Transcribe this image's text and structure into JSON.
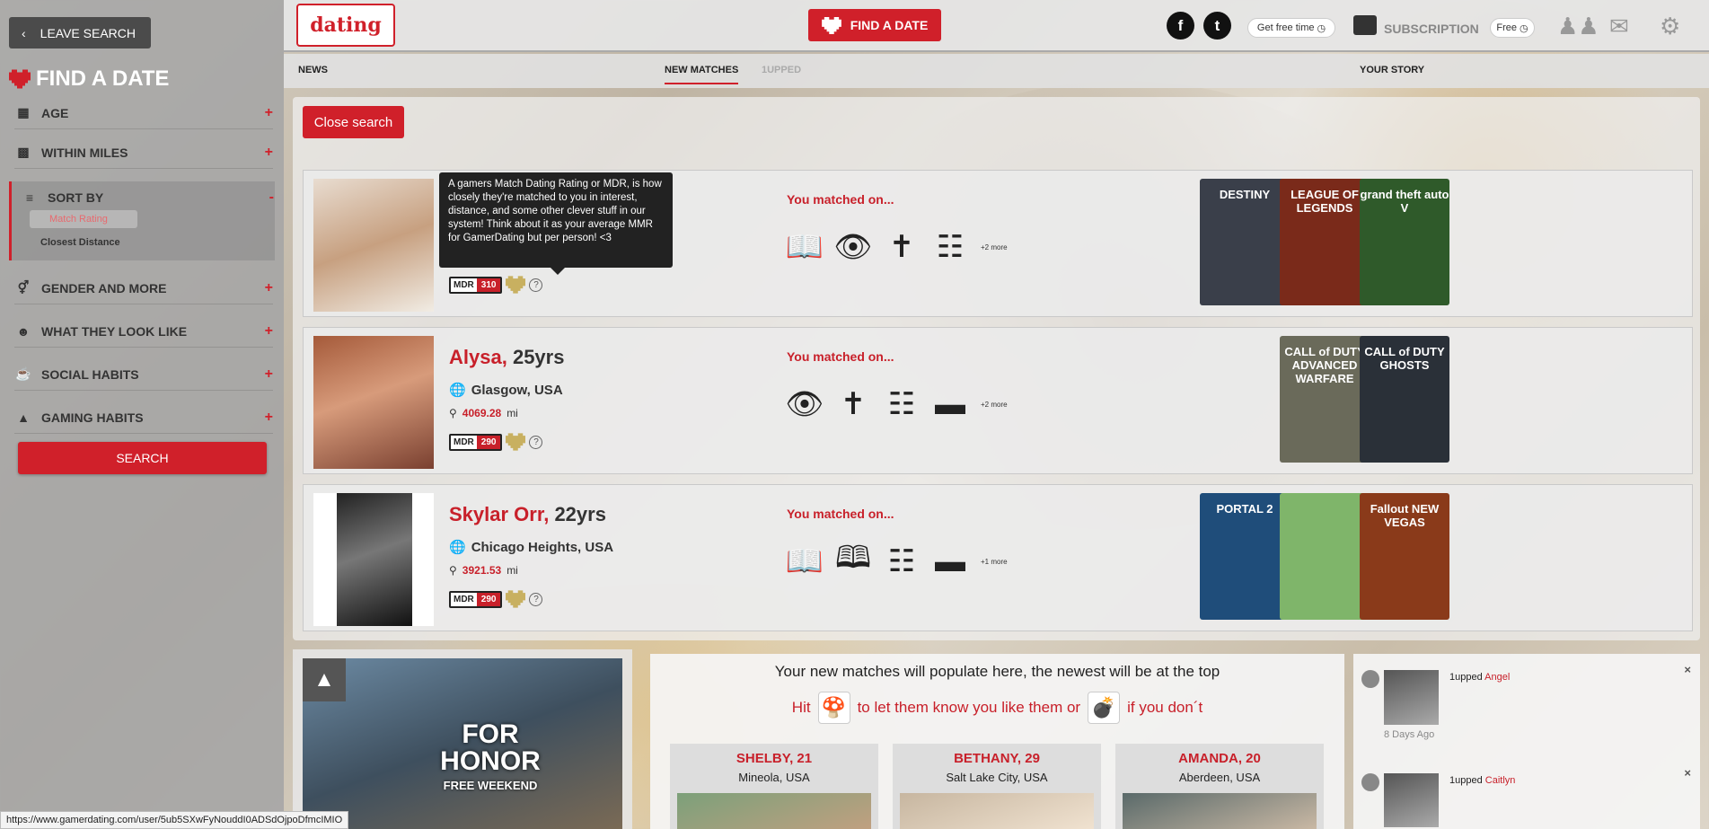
{
  "sidebar": {
    "leave_search": "LEAVE SEARCH",
    "title": "FIND A DATE",
    "filters": [
      {
        "label": "AGE",
        "icon": "calendar-icon"
      },
      {
        "label": "WITHIN MILES",
        "icon": "car-icon"
      },
      {
        "label": "SORT BY",
        "icon": "sliders-icon",
        "expanded_symbol": "-"
      },
      {
        "label": "GENDER AND MORE",
        "icon": "gender-icon"
      },
      {
        "label": "WHAT THEY LOOK LIKE",
        "icon": "face-icon"
      },
      {
        "label": "SOCIAL HABITS",
        "icon": "cup-icon"
      },
      {
        "label": "GAMING HABITS",
        "icon": "gamepad-icon"
      }
    ],
    "plus": "+",
    "sort_options": [
      "Match Rating",
      "Closest Distance"
    ],
    "search_button": "SEARCH"
  },
  "header": {
    "logo_text": "dating",
    "find_date": "FIND A DATE",
    "get_free_time": "Get free time",
    "subscription": "SUBSCRIPTION",
    "free": "Free"
  },
  "tabs": {
    "news": "NEWS",
    "new_matches": "NEW MATCHES",
    "oneupped": "1UPPED",
    "your_story": "YOUR STORY"
  },
  "results": {
    "close_search": "Close search",
    "matched_on_label": "You matched on...",
    "mdr_label": "MDR",
    "help": "?",
    "tooltip": "A gamers Match Dating Rating or MDR, is how closely they're matched to you in interest, distance, and some other clever stuff in our system! Think about it as your average MMR for GamerDating but per person! <3",
    "cards": [
      {
        "name": "",
        "age": "",
        "location": "",
        "distance": "",
        "distance_unit": "",
        "mdr": "310",
        "more": "+2 more",
        "match_icons": [
          "bible-icon",
          "eye-icon",
          "cross-icon",
          "glass-icon"
        ],
        "games": [
          {
            "title": "DESTINY",
            "color": "#3a3f4a"
          },
          {
            "title": "LEAGUE OF LEGENDS",
            "color": "#7a2a1a"
          },
          {
            "title": "grand theft auto V",
            "color": "#2f5a2a"
          }
        ]
      },
      {
        "name": "Alysa,",
        "age": "25yrs",
        "location": "Glasgow, USA",
        "distance": "4069.28",
        "distance_unit": "mi",
        "mdr": "290",
        "more": "+2 more",
        "match_icons": [
          "eye-icon",
          "cross-icon",
          "glass-icon",
          "cigarette-icon"
        ],
        "games": [
          {
            "title": "CALL of DUTY ADVANCED WARFARE",
            "color": "#6a6a5a"
          },
          {
            "title": "CALL of DUTY GHOSTS",
            "color": "#2a3038"
          }
        ]
      },
      {
        "name": "Skylar Orr,",
        "age": "22yrs",
        "location": "Chicago Heights, USA",
        "distance": "3921.53",
        "distance_unit": "mi",
        "mdr": "290",
        "more": "+1 more",
        "match_icons": [
          "bible-icon",
          "book-icon",
          "glass-icon",
          "cigarette-icon"
        ],
        "games": [
          {
            "title": "PORTAL 2",
            "color": "#1f4d7a"
          },
          {
            "title": "",
            "color": "#7fb56a"
          },
          {
            "title": "Fallout NEW VEGAS",
            "color": "#8a3a1a"
          }
        ]
      }
    ]
  },
  "promo": {
    "title": "FOR HONOR",
    "subtitle": "FREE WEEKEND"
  },
  "new_matches": {
    "title": "Your new matches will populate here, the newest will be at the top",
    "hint_hit": "Hit",
    "hint_mid": "to let them know you like them or",
    "hint_end": "if you don´t",
    "cards": [
      {
        "name": "SHELBY, 21",
        "city": "Mineola, USA"
      },
      {
        "name": "BETHANY, 29",
        "city": "Salt Lake City, USA"
      },
      {
        "name": "AMANDA, 20",
        "city": "Aberdeen, USA"
      }
    ]
  },
  "activity": {
    "items": [
      {
        "action": "1upped",
        "who": "Angel",
        "time": "8 Days Ago"
      },
      {
        "action": "1upped",
        "who": "Caitlyn",
        "time": ""
      }
    ],
    "close": "×"
  },
  "status_url": "https://www.gamerdating.com/user/5ub5SXwFyNouddI0ADSdOjpoDfmcIMIO",
  "colors": {
    "accent": "#d0202a",
    "sidebar": "#a5a5a5"
  }
}
